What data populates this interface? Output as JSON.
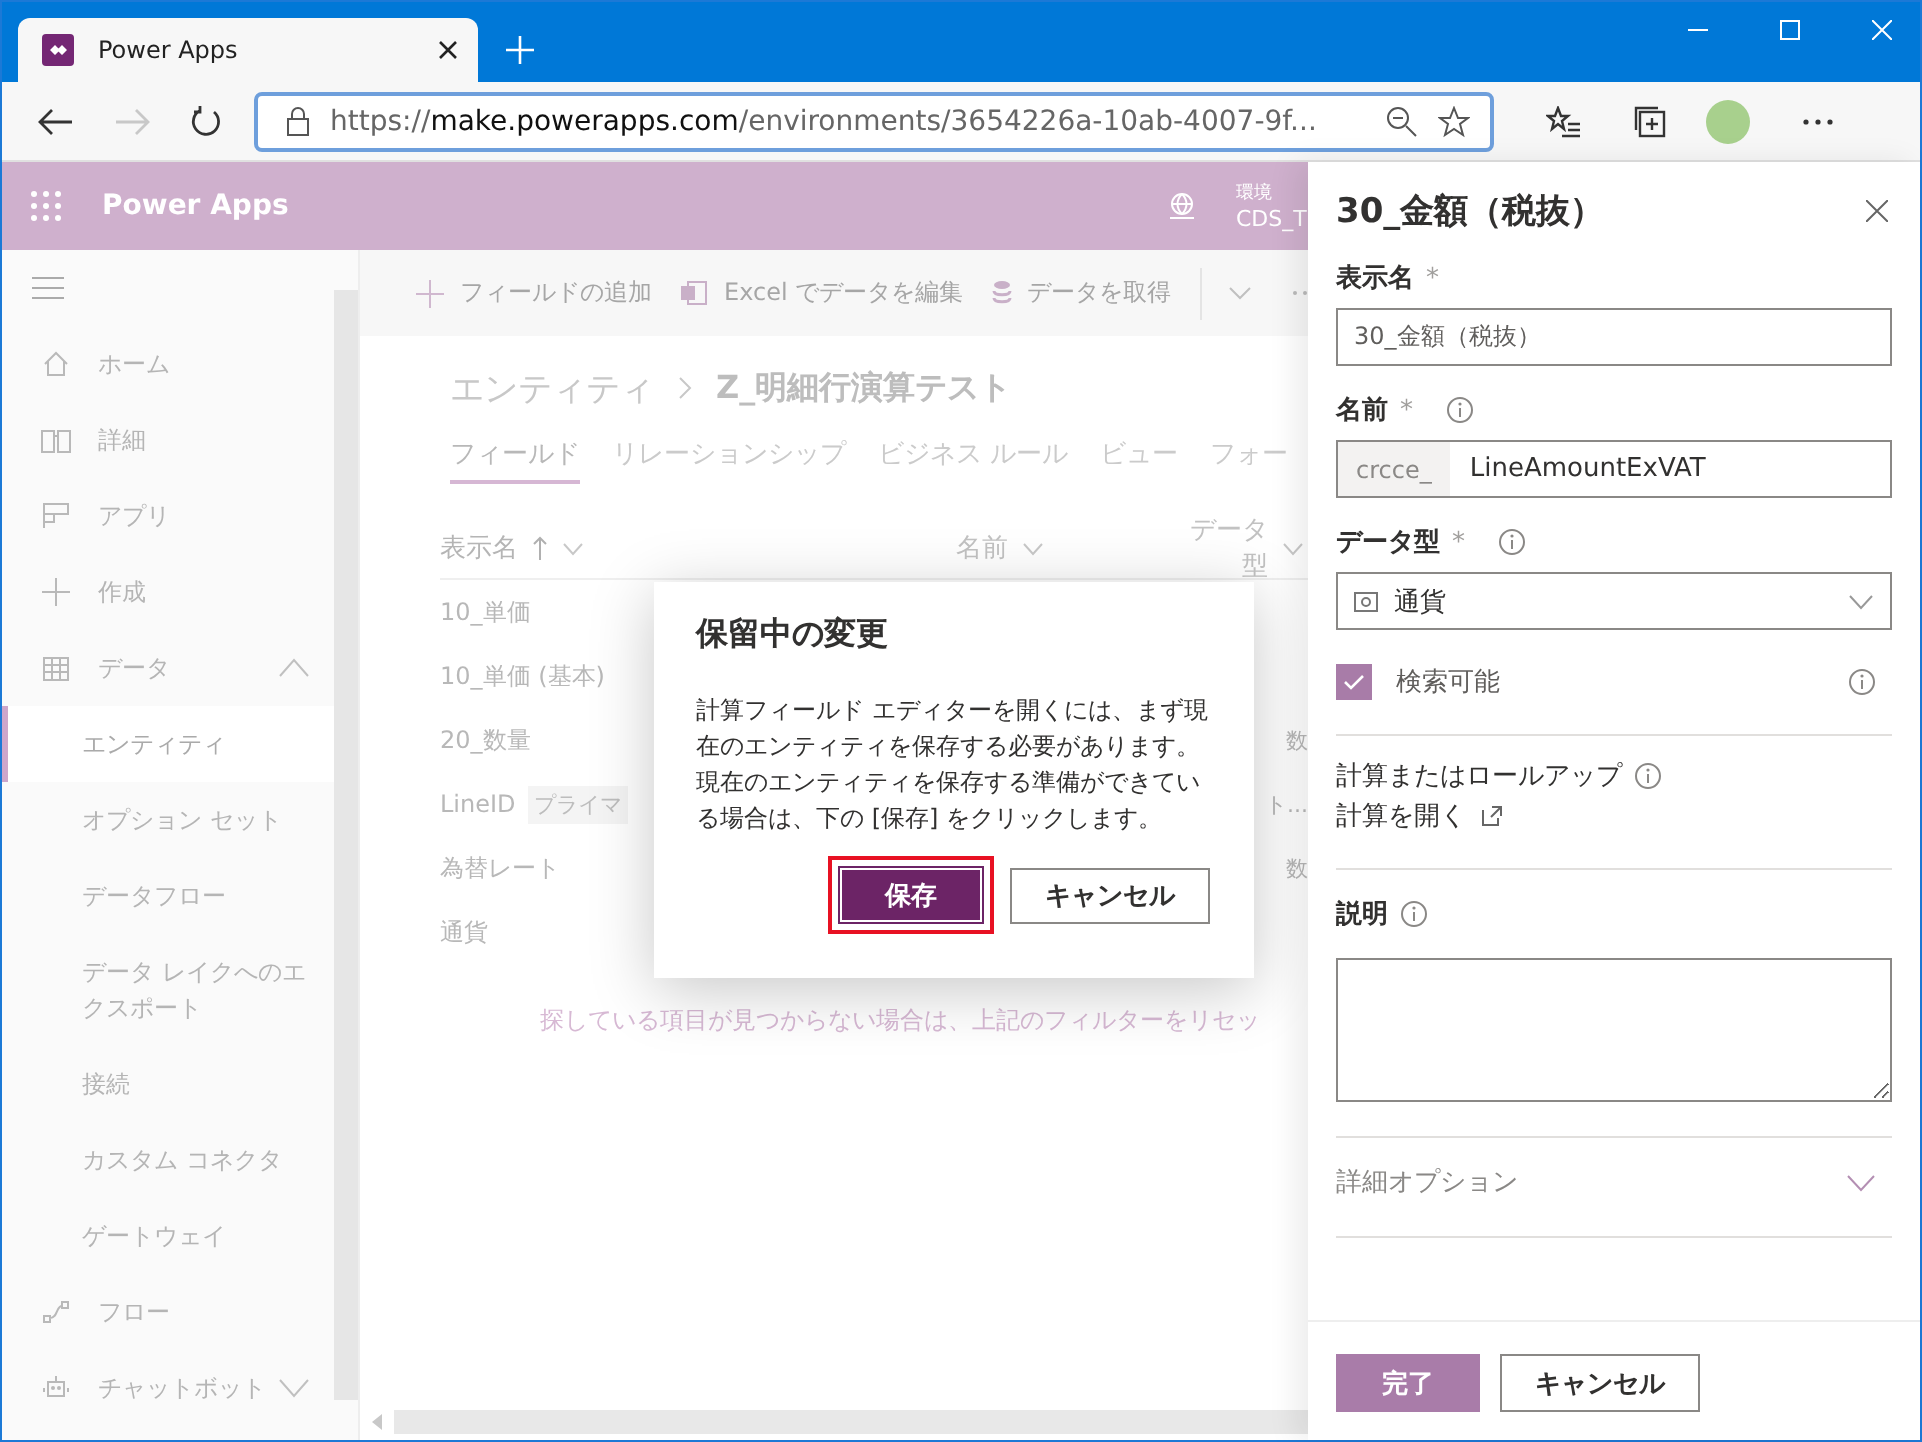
{
  "browser": {
    "tab_title": "Power Apps",
    "url": {
      "scheme": "https://",
      "host": "make.powerapps.com",
      "path": "/environments/3654226a-10ab-4007-9f..."
    },
    "forward_disabled": true
  },
  "app_header": {
    "title": "Power Apps",
    "environment_label": "環境",
    "environment_name": "CDS_T"
  },
  "nav": {
    "items": [
      {
        "label": "ホーム",
        "selected": false
      },
      {
        "label": "詳細",
        "selected": false
      },
      {
        "label": "アプリ",
        "selected": false
      },
      {
        "label": "作成",
        "selected": false
      },
      {
        "label": "データ",
        "selected": false,
        "expanded": true,
        "children": [
          {
            "label": "エンティティ",
            "selected": true
          },
          {
            "label": "オプション セット",
            "selected": false
          },
          {
            "label": "データフロー",
            "selected": false
          },
          {
            "label": "データ レイクへのエクスポート",
            "selected": false
          },
          {
            "label": "接続",
            "selected": false
          },
          {
            "label": "カスタム コネクタ",
            "selected": false
          },
          {
            "label": "ゲートウェイ",
            "selected": false
          }
        ]
      },
      {
        "label": "フロー",
        "selected": false
      },
      {
        "label": "チャットボット",
        "selected": false,
        "expanded": false
      }
    ]
  },
  "toolbar": {
    "commands": [
      {
        "label": "フィールドの追加"
      },
      {
        "label": "Excel でデータを編集"
      },
      {
        "label": "データを取得"
      }
    ]
  },
  "breadcrumb": {
    "parent": "エンティティ",
    "current": "Z_明細行演算テスト"
  },
  "tabs": [
    {
      "label": "フィールド",
      "selected": true
    },
    {
      "label": "リレーションシップ",
      "selected": false
    },
    {
      "label": "ビジネス ルール",
      "selected": false
    },
    {
      "label": "ビュー",
      "selected": false
    },
    {
      "label": "フォー",
      "selected": false
    }
  ],
  "table": {
    "columns": [
      {
        "label": "表示名",
        "sorted": true
      },
      {
        "label": "名前",
        "sorted": false
      },
      {
        "label": "データ型",
        "sorted": false
      }
    ],
    "rows": [
      {
        "display_name": "10_単価",
        "column_3": ""
      },
      {
        "display_name": "10_単価 (基本)",
        "column_3": ""
      },
      {
        "display_name": "20_数量",
        "column_3": "数"
      },
      {
        "display_name": "LineID",
        "tag": "プライマ",
        "column_3": "ト..."
      },
      {
        "display_name": "為替レート",
        "column_3": "数"
      },
      {
        "display_name": "通貨",
        "column_3": ""
      }
    ]
  },
  "empty_message": "探している項目が見つからない場合は、上記のフィルターをリセッ",
  "dialog": {
    "title": "保留中の変更",
    "body": "計算フィールド エディターを開くには、まず現在のエンティティを保存する必要があります。現在のエンティティを保存する準備ができている場合は、下の [保存] をクリックします。",
    "primary_button": "保存",
    "secondary_button": "キャンセル",
    "primary_highlighted": true
  },
  "panel": {
    "title": "30_金額（税抜）",
    "display_name": {
      "label": "表示名",
      "required_mark": "*",
      "value": "30_金額（税抜）"
    },
    "name": {
      "label": "名前",
      "required_mark": "*",
      "prefix": "crcce_",
      "value": "LineAmountExVAT"
    },
    "data_type": {
      "label": "データ型",
      "required_mark": "*",
      "value": "通貨"
    },
    "searchable": {
      "label": "検索可能",
      "checked": true
    },
    "calculated": {
      "label": "計算またはロールアップ",
      "link": "計算を開く"
    },
    "description": {
      "label": "説明"
    },
    "advanced": {
      "label": "詳細オプション",
      "expanded": false
    },
    "buttons": [
      {
        "label": "完了",
        "kind": "primary"
      },
      {
        "label": "キャンセル",
        "kind": "secondary"
      }
    ]
  }
}
